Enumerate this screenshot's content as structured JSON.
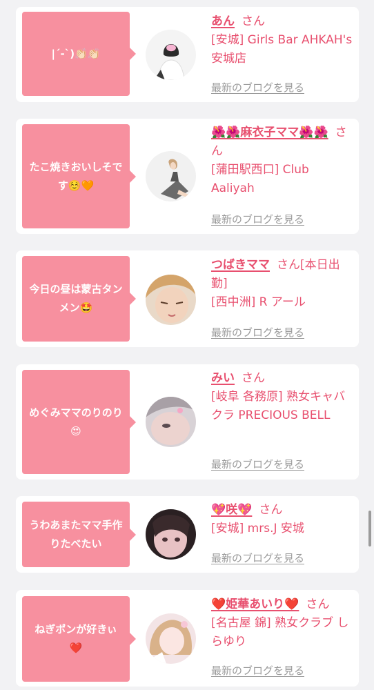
{
  "accent_color": "#e8506f",
  "bubble_color": "#f7909f",
  "posts": [
    {
      "message": "|´-`)👏🏻👏🏻",
      "name": "あん",
      "suffix": "さん",
      "shop": "[安城] Girls Bar AHKAH's 安城店",
      "blog_link": "最新のブログを見る",
      "avatar_icon": "hostess-photo-avatar"
    },
    {
      "message": "たこ焼きおいしそです☺️🧡",
      "name": "🌺🌺麻衣子ママ🌺🌺",
      "suffix": "さん",
      "shop": "[蒲田駅西口] Club Aaliyah",
      "blog_link": "最新のブログを見る",
      "avatar_icon": "hostess-photo-avatar"
    },
    {
      "message": "今日の昼は蒙古タンメン🤩",
      "name": "つばきママ",
      "suffix": "さん[本日出勤]",
      "shop": "[西中洲] R アール",
      "blog_link": "最新のブログを見る",
      "avatar_icon": "hostess-photo-avatar"
    },
    {
      "message": "めぐみママのりのり😍",
      "name": "みい",
      "suffix": "さん",
      "shop": "[岐阜 各務原] 熟女キャバクラ PRECIOUS BELL",
      "blog_link": "最新のブログを見る",
      "avatar_icon": "hostess-photo-avatar"
    },
    {
      "message": "うわあまたママ手作りたべたい",
      "name": "💖咲💖",
      "suffix": "さん",
      "shop": "[安城] mrs.J 安城",
      "blog_link": "最新のブログを見る",
      "avatar_icon": "hostess-photo-avatar"
    },
    {
      "message": "ねぎポンが好きぃ❤️",
      "name": "❤️姫華あいり❤️",
      "suffix": "さん",
      "shop": "[名古屋 錦] 熟女クラブ しらゆり",
      "blog_link": "最新のブログを見る",
      "avatar_icon": "hostess-photo-avatar"
    }
  ]
}
